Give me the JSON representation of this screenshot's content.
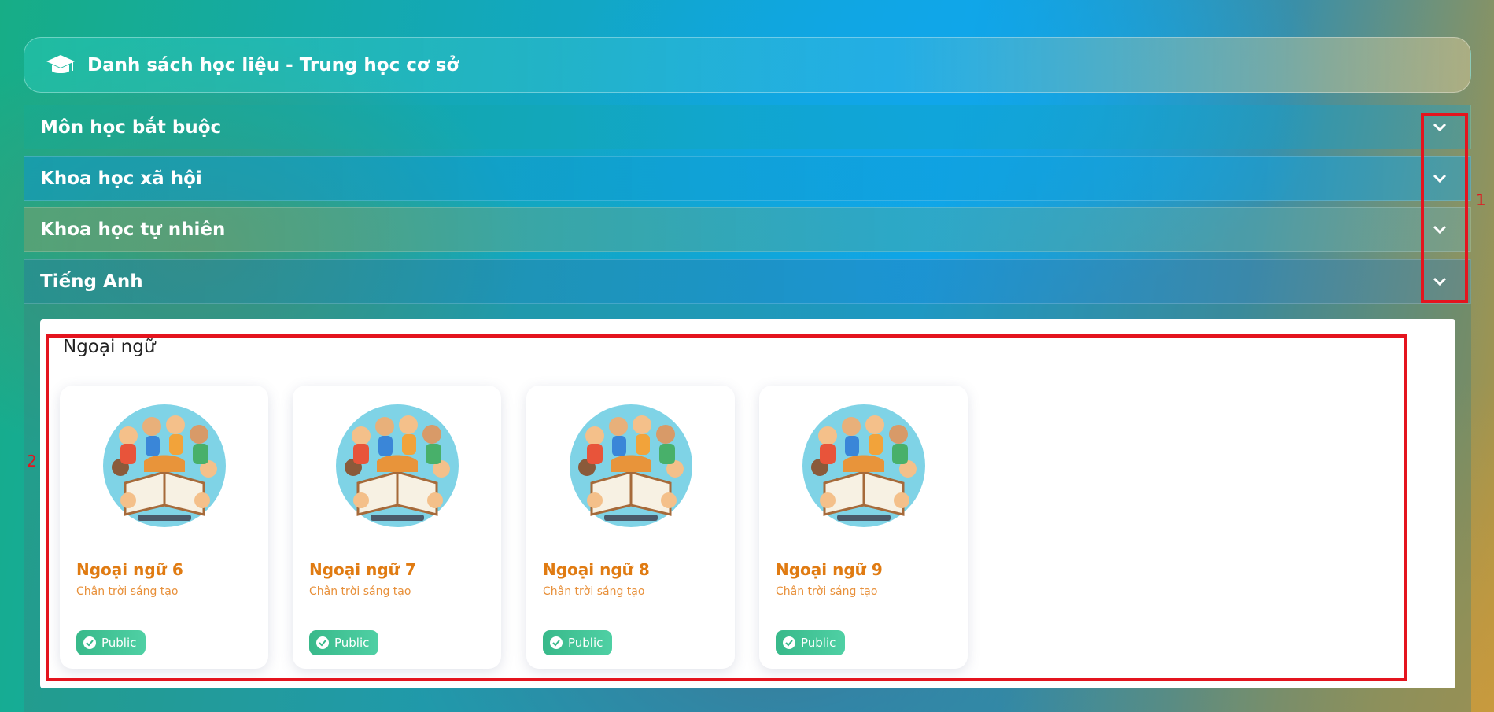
{
  "header": {
    "title": "Danh sách học liệu - Trung học cơ sở",
    "icon": "graduation-cap-icon"
  },
  "accordions": [
    {
      "label": "Môn học bắt buộc"
    },
    {
      "label": "Khoa học xã hội"
    },
    {
      "label": "Khoa học tự nhiên"
    },
    {
      "label": "Tiếng Anh"
    }
  ],
  "section": {
    "title": "Ngoại ngữ",
    "cards": [
      {
        "name": "Ngoại ngữ 6",
        "publisher": "Chân trời sáng tạo",
        "badge": "Public"
      },
      {
        "name": "Ngoại ngữ 7",
        "publisher": "Chân trời sáng tạo",
        "badge": "Public"
      },
      {
        "name": "Ngoại ngữ 8",
        "publisher": "Chân trời sáng tạo",
        "badge": "Public"
      },
      {
        "name": "Ngoại ngữ 9",
        "publisher": "Chân trời sáng tạo",
        "badge": "Public"
      }
    ]
  },
  "annotations": {
    "label_1": "1",
    "label_2": "2",
    "color": "#e4141e"
  },
  "colors": {
    "card_title": "#e07b12",
    "badge": "#38b98a"
  }
}
